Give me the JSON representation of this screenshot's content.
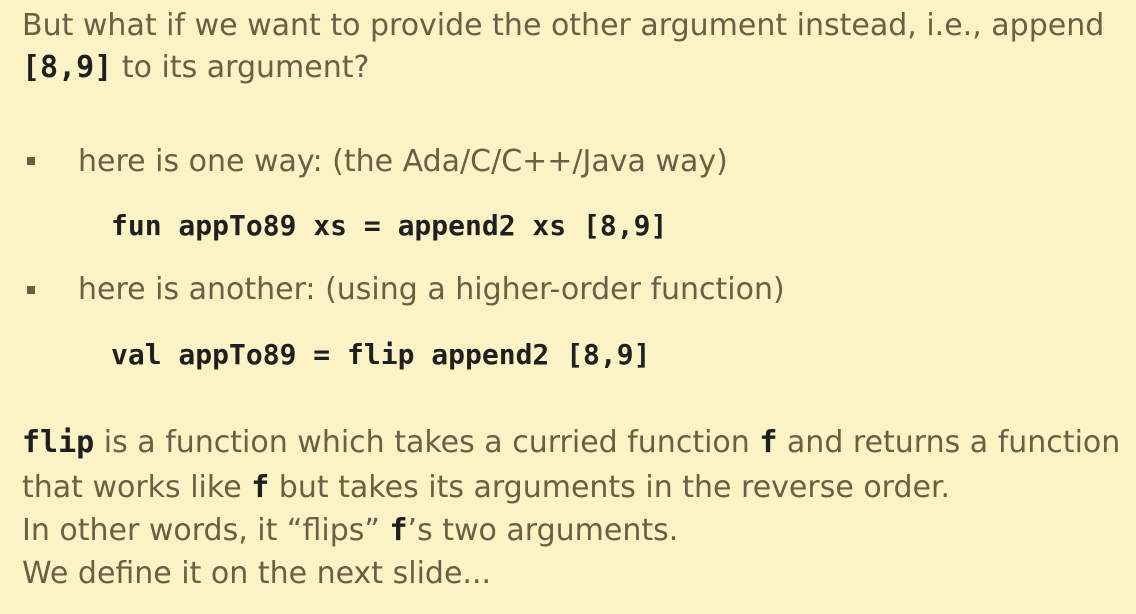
{
  "intro": {
    "line1": "But what if we want to provide the other argument instead, i.e., append",
    "line2_code": "[8,9]",
    "line2_text": " to its argument?"
  },
  "bullets": [
    {
      "text": "here is one way: (the Ada/C/C++/Java way)",
      "code": "fun appTo89 xs = append2 xs [8,9]"
    },
    {
      "text": "here is another: (using a higher-order function)",
      "code": "val appTo89 = flip append2 [8,9]"
    }
  ],
  "outro": {
    "line1_code_a": "flip",
    "line1_text_a": " is a function which takes a curried function ",
    "line1_code_b": "f",
    "line1_text_b": " and returns a function",
    "line2_text_a": "that works like ",
    "line2_code": "f",
    "line2_text_b": " but takes its arguments in the reverse order.",
    "line3_text_a": "In other words, it “flips” ",
    "line3_code": "f",
    "line3_text_b": "’s two arguments.",
    "line4": "We define it on the next slide..."
  }
}
